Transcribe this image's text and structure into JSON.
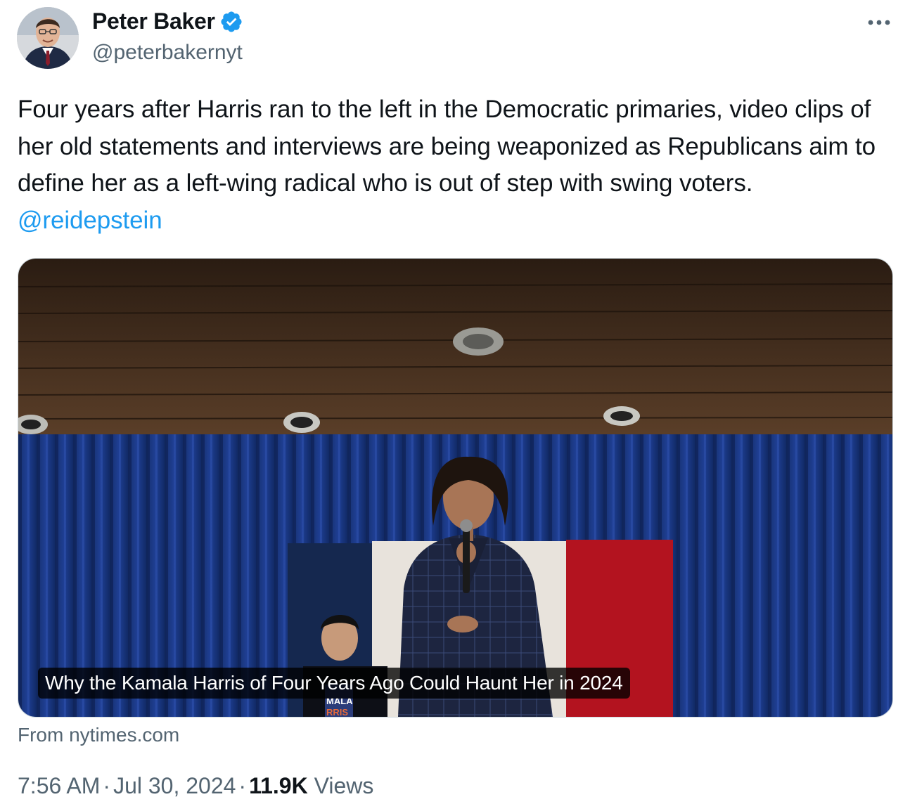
{
  "author": {
    "name": "Peter Baker",
    "handle": "@peterbakernyt",
    "verified": true,
    "avatar_icon": "profile-photo"
  },
  "tweet": {
    "text": "Four years after Harris ran to the left in the Democratic primaries, video clips of her old statements and interviews are being weaponized as Republicans aim to define her as a left-wing radical who is out of step with swing voters. ",
    "mention": "@reidepstein"
  },
  "card": {
    "title": "Why the Kamala Harris of Four Years Ago Could Haunt Her in 2024",
    "source": "From nytimes.com",
    "sign_text_1": "MALA",
    "sign_text_2": "RRIS"
  },
  "meta": {
    "time": "7:56 AM",
    "date": "Jul 30, 2024",
    "views_count": "11.9K",
    "views_label": "Views",
    "separator": "·"
  },
  "colors": {
    "link": "#1d9bf0",
    "verified": "#1d9bf0",
    "secondary_text": "#536471",
    "curtain": "#1e3a8a"
  },
  "icons": {
    "verified": "verified-badge-icon",
    "more": "more-horizontal-icon"
  }
}
